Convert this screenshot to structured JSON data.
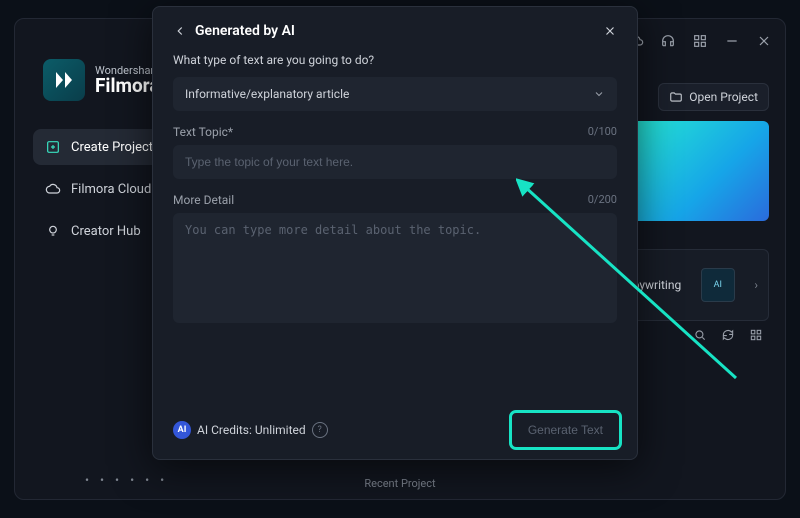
{
  "brand": {
    "line1": "Wondershare",
    "line2": "Filmora"
  },
  "titlebar": {
    "open_project": "Open Project"
  },
  "menu": {
    "create": "Create Project",
    "cloud": "Filmora Cloud",
    "hub": "Creator Hub"
  },
  "preview": {
    "copywriting": "Copywriting"
  },
  "recent": "Recent Project",
  "dots": "• • • • • •",
  "modal": {
    "title": "Generated by AI",
    "question": "What type of text are you going to do?",
    "select_value": "Informative/explanatory article",
    "topic_label": "Text Topic*",
    "topic_count": "0/100",
    "topic_placeholder": "Type the topic of your text here.",
    "detail_label": "More Detail",
    "detail_count": "0/200",
    "detail_placeholder": "You can type more detail about the topic.",
    "credits_badge": "AI",
    "credits_text": "AI Credits: Unlimited",
    "generate": "Generate Text"
  }
}
